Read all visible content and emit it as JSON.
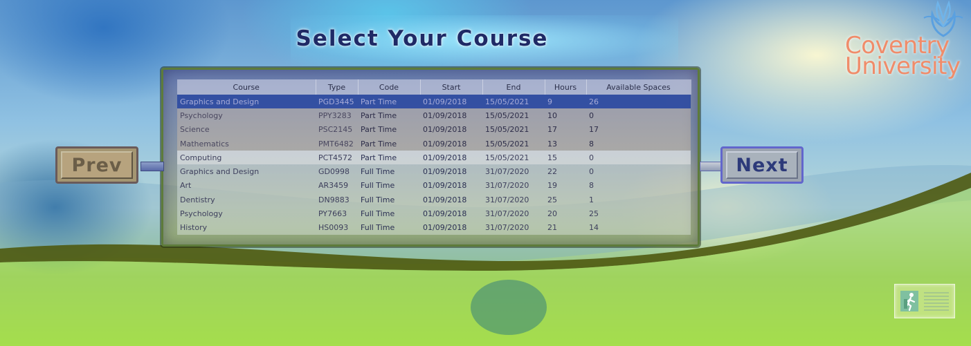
{
  "app": {
    "title": "Select Your Course",
    "logo": {
      "line1": "Coventry",
      "line2": "University",
      "color": "#f08c6a"
    }
  },
  "table": {
    "columns": [
      "Course",
      "Type",
      "Code",
      "Start",
      "End",
      "Hours",
      "Available Spaces"
    ],
    "rows": [
      [
        "Graphics and Design",
        "PGD3445",
        "Part Time",
        "01/09/2018",
        "15/05/2021",
        "9",
        "26"
      ],
      [
        "Psychology",
        "PPY3283",
        "Part Time",
        "01/09/2018",
        "15/05/2021",
        "10",
        "0"
      ],
      [
        "Science",
        "PSC2145",
        "Part Time",
        "01/09/2018",
        "15/05/2021",
        "17",
        "17"
      ],
      [
        "Mathematics",
        "PMT6482",
        "Part Time",
        "01/09/2018",
        "15/05/2021",
        "13",
        "8"
      ],
      [
        "Computing",
        "PCT4572",
        "Part Time",
        "01/09/2018",
        "15/05/2021",
        "15",
        "0"
      ],
      [
        "Graphics and Design",
        "GD0998",
        "Full Time",
        "01/09/2018",
        "31/07/2020",
        "22",
        "0"
      ],
      [
        "Art",
        "AR3459",
        "Full Time",
        "01/09/2018",
        "31/07/2020",
        "19",
        "8"
      ],
      [
        "Dentistry",
        "DN9883",
        "Full Time",
        "01/09/2018",
        "31/07/2020",
        "25",
        "1"
      ],
      [
        "Psychology",
        "PY7663",
        "Full Time",
        "01/09/2018",
        "31/07/2020",
        "20",
        "25"
      ],
      [
        "History",
        "HS0093",
        "Full Time",
        "01/09/2018",
        "31/07/2020",
        "21",
        "14"
      ]
    ],
    "selected_row": 0
  },
  "nav": {
    "prev_label": "Prev",
    "next_label": "Next"
  },
  "exit": {
    "icon": "exit-icon"
  },
  "colors": {
    "title": "#1f2a66",
    "selection": "#2846a0",
    "panel_border": "#5d7b3a"
  }
}
